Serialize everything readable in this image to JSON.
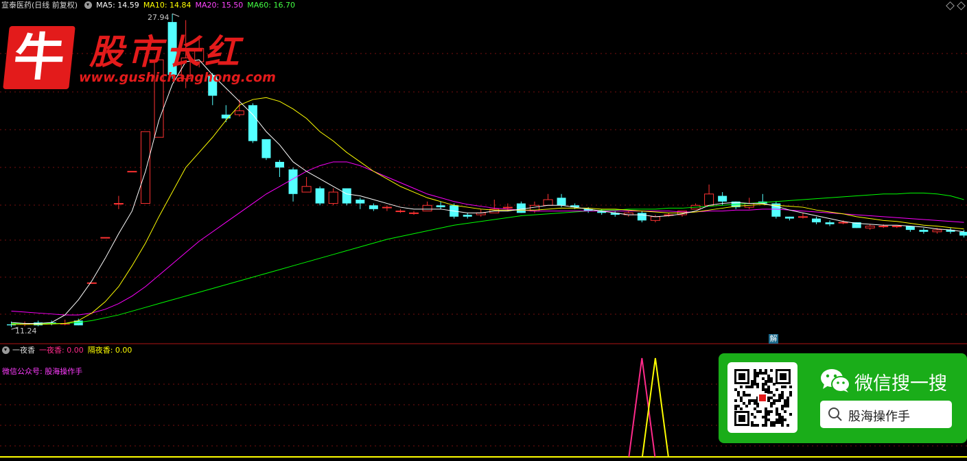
{
  "header": {
    "stock_title": "宣泰医药(日线 前复权)",
    "ma5": "MA5: 14.59",
    "ma10": "MA10: 14.84",
    "ma20": "MA20: 15.50",
    "ma60": "MA60: 16.70"
  },
  "colors": {
    "ma5": "#ffffff",
    "ma10": "#ffff00",
    "ma20": "#ff00ff",
    "ma60": "#00ff00",
    "up": "#ff3232",
    "down": "#54ffff",
    "grid": "#7a1010",
    "pink": "#ff2a8a",
    "yellow": "#ffff00"
  },
  "chart_labels": {
    "high": "27.94",
    "low": "11.24",
    "jie": "解"
  },
  "indicator": {
    "name": "一夜香",
    "v1": "一夜香: 0.00",
    "v2": "隔夜香: 0.00",
    "wechat": "微信公众号: 股海操作手"
  },
  "watermark": {
    "logo_char": "牛",
    "title": "股市长红",
    "url": "www.gushichanghong.com"
  },
  "wechat_card": {
    "title": "微信搜一搜",
    "search": "股海操作手"
  },
  "icons": [
    "dropdown-icon",
    "diamond-icon",
    "wechat-icon",
    "search-icon",
    "qr-code-icon"
  ],
  "chart_data": {
    "type": "candlestick",
    "ylim": [
      11.24,
      27.94
    ],
    "high_label": 27.94,
    "low_label": 11.24,
    "candles": [
      [
        11.5,
        11.45,
        11.65,
        11.35
      ],
      [
        11.5,
        11.55,
        11.65,
        11.4
      ],
      [
        11.6,
        11.45,
        11.7,
        11.4
      ],
      [
        11.6,
        11.55,
        11.7,
        11.45
      ],
      [
        11.55,
        11.55,
        11.75,
        11.45
      ],
      [
        11.7,
        11.45,
        11.8,
        11.45
      ],
      [
        13.7,
        13.7,
        13.7,
        13.7
      ],
      [
        16.1,
        16.1,
        16.1,
        16.1
      ],
      [
        17.9,
        17.9,
        18.3,
        17.6
      ],
      [
        19.6,
        19.6,
        19.6,
        19.6
      ],
      [
        17.9,
        21.7,
        21.7,
        17.9
      ],
      [
        21.4,
        25.5,
        25.5,
        21.4
      ],
      [
        27.5,
        24.7,
        27.94,
        24.5
      ],
      [
        24.5,
        25.6,
        27.6,
        24.0
      ],
      [
        25.4,
        26.1,
        26.6,
        25.1
      ],
      [
        24.7,
        23.6,
        24.8,
        23.1
      ],
      [
        22.6,
        22.4,
        23.1,
        22.2
      ],
      [
        22.6,
        22.8,
        23.4,
        22.5
      ],
      [
        23.1,
        21.2,
        23.2,
        21.1
      ],
      [
        21.3,
        20.3,
        21.3,
        20.2
      ],
      [
        20.1,
        19.8,
        20.2,
        19.3
      ],
      [
        19.7,
        18.4,
        19.8,
        18.0
      ],
      [
        18.5,
        18.8,
        19.3,
        18.5
      ],
      [
        18.7,
        17.9,
        18.8,
        17.8
      ],
      [
        17.9,
        18.5,
        18.7,
        17.8
      ],
      [
        18.7,
        17.9,
        18.7,
        17.8
      ],
      [
        18.1,
        17.9,
        18.2,
        17.6
      ],
      [
        17.8,
        17.6,
        17.9,
        17.5
      ],
      [
        17.7,
        17.7,
        17.8,
        17.5
      ],
      [
        17.5,
        17.5,
        17.6,
        17.4
      ],
      [
        17.4,
        17.4,
        17.5,
        17.3
      ],
      [
        17.5,
        17.8,
        18.0,
        17.5
      ],
      [
        17.8,
        17.7,
        18.0,
        17.6
      ],
      [
        17.8,
        17.2,
        17.9,
        17.1
      ],
      [
        17.3,
        17.2,
        17.4,
        17.1
      ],
      [
        17.3,
        17.4,
        17.6,
        17.2
      ],
      [
        17.4,
        17.6,
        18.1,
        17.4
      ],
      [
        17.7,
        17.7,
        17.9,
        17.5
      ],
      [
        17.9,
        17.4,
        18.0,
        17.4
      ],
      [
        17.5,
        17.8,
        18.0,
        17.4
      ],
      [
        17.8,
        18.1,
        18.4,
        17.8
      ],
      [
        18.2,
        17.8,
        18.4,
        17.7
      ],
      [
        17.8,
        17.7,
        17.9,
        17.6
      ],
      [
        17.6,
        17.5,
        17.7,
        17.4
      ],
      [
        17.5,
        17.4,
        17.6,
        17.3
      ],
      [
        17.4,
        17.3,
        17.5,
        17.2
      ],
      [
        17.3,
        17.4,
        17.5,
        17.2
      ],
      [
        17.4,
        17.0,
        17.5,
        16.9
      ],
      [
        17.0,
        17.2,
        17.3,
        16.9
      ],
      [
        17.3,
        17.3,
        17.4,
        17.2
      ],
      [
        17.3,
        17.5,
        17.5,
        17.2
      ],
      [
        17.6,
        17.8,
        17.9,
        17.6
      ],
      [
        17.8,
        18.4,
        18.9,
        17.8
      ],
      [
        18.3,
        18.0,
        18.5,
        17.8
      ],
      [
        18.0,
        17.7,
        18.0,
        17.6
      ],
      [
        17.7,
        17.9,
        18.2,
        17.6
      ],
      [
        18.0,
        17.9,
        18.4,
        17.9
      ],
      [
        17.9,
        17.2,
        18.0,
        17.1
      ],
      [
        17.2,
        17.1,
        17.2,
        17.0
      ],
      [
        17.2,
        17.2,
        17.4,
        17.1
      ],
      [
        17.1,
        16.9,
        17.2,
        16.8
      ],
      [
        16.9,
        16.8,
        17.0,
        16.7
      ],
      [
        16.9,
        16.9,
        17.0,
        16.8
      ],
      [
        16.9,
        16.6,
        16.9,
        16.6
      ],
      [
        16.6,
        16.7,
        16.8,
        16.5
      ],
      [
        16.7,
        16.7,
        16.8,
        16.6
      ],
      [
        16.7,
        16.7,
        16.7,
        16.6
      ],
      [
        16.7,
        16.5,
        16.7,
        16.4
      ],
      [
        16.5,
        16.4,
        16.6,
        16.3
      ],
      [
        16.4,
        16.5,
        16.6,
        16.3
      ],
      [
        16.5,
        16.4,
        16.6,
        16.3
      ],
      [
        16.4,
        16.2,
        16.5,
        16.1
      ]
    ],
    "ma5_line": [
      11.6,
      11.55,
      11.55,
      11.6,
      12.0,
      12.8,
      13.8,
      15.0,
      16.3,
      17.5,
      19.6,
      22.3,
      24.2,
      25.4,
      25.5,
      24.7,
      24.0,
      23.3,
      22.6,
      21.7,
      21.0,
      20.1,
      19.6,
      19.2,
      18.8,
      18.4,
      18.3,
      18.1,
      17.9,
      17.7,
      17.6,
      17.6,
      17.6,
      17.5,
      17.4,
      17.4,
      17.5,
      17.5,
      17.6,
      17.7,
      17.8,
      17.8,
      17.7,
      17.6,
      17.5,
      17.4,
      17.3,
      17.3,
      17.2,
      17.25,
      17.35,
      17.5,
      17.8,
      17.9,
      17.95,
      17.9,
      17.9,
      17.75,
      17.55,
      17.4,
      17.25,
      17.1,
      16.95,
      16.85,
      16.8,
      16.75,
      16.75,
      16.7,
      16.65,
      16.55,
      16.5,
      16.4
    ],
    "ma10_line": [
      11.5,
      11.5,
      11.5,
      11.52,
      11.55,
      11.7,
      12.1,
      12.7,
      13.5,
      14.6,
      15.8,
      17.2,
      18.5,
      19.8,
      20.6,
      21.4,
      22.3,
      23.1,
      23.4,
      23.5,
      23.3,
      22.9,
      22.4,
      21.7,
      21.2,
      20.6,
      20.1,
      19.6,
      19.2,
      18.8,
      18.5,
      18.2,
      18.0,
      17.8,
      17.7,
      17.6,
      17.55,
      17.55,
      17.55,
      17.55,
      17.6,
      17.65,
      17.65,
      17.65,
      17.6,
      17.6,
      17.55,
      17.5,
      17.45,
      17.4,
      17.4,
      17.45,
      17.55,
      17.65,
      17.75,
      17.8,
      17.85,
      17.8,
      17.75,
      17.7,
      17.55,
      17.45,
      17.35,
      17.2,
      17.1,
      17.0,
      16.95,
      16.85,
      16.75,
      16.7,
      16.62,
      16.55
    ],
    "ma20_line": [
      12.2,
      12.15,
      12.1,
      12.05,
      12.0,
      12.0,
      12.1,
      12.3,
      12.6,
      13.0,
      13.5,
      14.1,
      14.7,
      15.3,
      15.9,
      16.4,
      16.9,
      17.4,
      17.9,
      18.4,
      18.8,
      19.2,
      19.6,
      19.9,
      20.1,
      20.1,
      19.9,
      19.6,
      19.3,
      19.0,
      18.7,
      18.4,
      18.2,
      18.0,
      17.85,
      17.75,
      17.65,
      17.6,
      17.55,
      17.5,
      17.5,
      17.5,
      17.5,
      17.5,
      17.5,
      17.5,
      17.5,
      17.5,
      17.5,
      17.5,
      17.45,
      17.45,
      17.5,
      17.5,
      17.55,
      17.55,
      17.6,
      17.6,
      17.55,
      17.5,
      17.45,
      17.4,
      17.35,
      17.3,
      17.25,
      17.2,
      17.15,
      17.1,
      17.05,
      17.0,
      16.95,
      16.9
    ],
    "ma60_line": [
      11.55,
      11.55,
      11.55,
      11.55,
      11.55,
      11.6,
      11.7,
      11.85,
      12.0,
      12.2,
      12.4,
      12.6,
      12.8,
      13.0,
      13.2,
      13.4,
      13.6,
      13.8,
      14.0,
      14.2,
      14.4,
      14.6,
      14.8,
      15.0,
      15.2,
      15.4,
      15.6,
      15.8,
      16.0,
      16.15,
      16.3,
      16.45,
      16.6,
      16.75,
      16.85,
      16.95,
      17.05,
      17.15,
      17.25,
      17.3,
      17.35,
      17.4,
      17.45,
      17.5,
      17.55,
      17.55,
      17.6,
      17.6,
      17.6,
      17.65,
      17.65,
      17.7,
      17.75,
      17.8,
      17.85,
      17.9,
      17.95,
      18.0,
      18.05,
      18.1,
      18.15,
      18.2,
      18.25,
      18.3,
      18.35,
      18.4,
      18.4,
      18.45,
      18.45,
      18.4,
      18.3,
      18.1
    ],
    "indicator_pink": {
      "x": 47,
      "peak": 1
    },
    "indicator_yellow": {
      "x": 48,
      "peak": 1
    }
  }
}
